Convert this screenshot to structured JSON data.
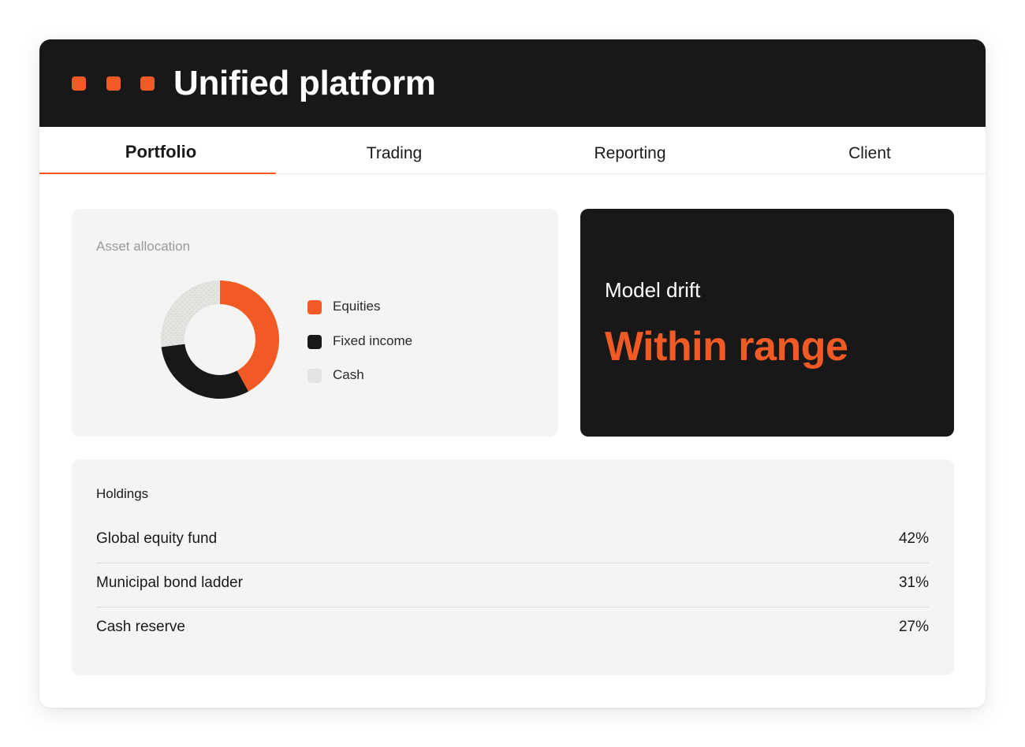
{
  "app": {
    "title": "Unified platform",
    "window_dots": [
      "orange",
      "orange",
      "orange"
    ]
  },
  "tabs": [
    {
      "label": "Portfolio",
      "active": true
    },
    {
      "label": "Trading",
      "active": false
    },
    {
      "label": "Reporting",
      "active": false
    },
    {
      "label": "Client",
      "active": false
    }
  ],
  "allocation": {
    "label": "Asset allocation",
    "legend": [
      {
        "label": "Equities",
        "color": "#f15a24"
      },
      {
        "label": "Fixed income",
        "color": "#181818"
      },
      {
        "label": "Cash",
        "color": "#e3e3e1"
      }
    ]
  },
  "chart_data": {
    "type": "pie",
    "title": "Asset allocation",
    "categories": [
      "Equities",
      "Fixed income",
      "Cash"
    ],
    "values": [
      42,
      31,
      27
    ],
    "colors": [
      "#f15a24",
      "#181818",
      "#e3e3e1"
    ],
    "legend_placement": "right"
  },
  "drift": {
    "label": "Model drift",
    "value": "Within range"
  },
  "holdings": {
    "title": "Holdings",
    "rows": [
      {
        "name": "Global equity fund",
        "value": "42%"
      },
      {
        "name": "Municipal bond ladder",
        "value": "31%"
      },
      {
        "name": "Cash reserve",
        "value": "27%"
      }
    ]
  },
  "colors": {
    "accent": "#f15a24",
    "dark": "#181818",
    "card_bg": "#f4f4f2"
  }
}
